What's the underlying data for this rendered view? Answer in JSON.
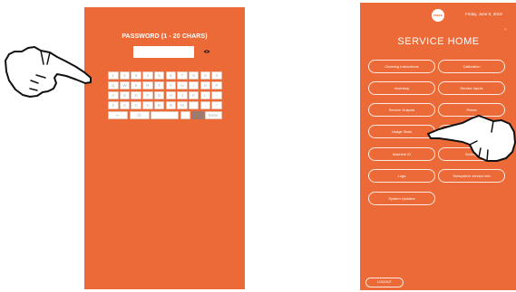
{
  "left_screen": {
    "title": "PASSWORD (1 - 20 CHARS)",
    "password_value": "",
    "eye_icon": "eye-icon",
    "keyboard_rows": [
      [
        "1",
        "2",
        "3",
        "4",
        "5",
        "6",
        "7",
        "8",
        "9",
        "0"
      ],
      [
        "Q",
        "W",
        "E",
        "R",
        "T",
        "Y",
        "U",
        "I",
        "O",
        "P"
      ],
      [
        "A",
        "S",
        "D",
        "F",
        "G",
        "H",
        "J",
        "K",
        "L",
        "-"
      ],
      [
        "Z",
        "X",
        "C",
        "V",
        "B",
        "N",
        "M",
        ".",
        ",",
        "/"
      ]
    ],
    "bottom_row": {
      "backspace_label": "⇐",
      "at_label": "@",
      "space_label": "",
      "period_label": ".",
      "shift_label": "",
      "enter_label": "Enter"
    }
  },
  "right_screen": {
    "logo_text": "FRESH BLENDS",
    "date": "Friday, June 8, 2018",
    "tiny_mark": "(((",
    "title": "SERVICE HOME",
    "buttons_left": [
      "Cleaning Instructions",
      "Inventory",
      "Service Outputs",
      "Usage Stats",
      "Machine ID",
      "Logs",
      "System Updates"
    ],
    "buttons_right": [
      "Calibration",
      "Service Inputs",
      "Prices",
      "",
      "Settings",
      "Subsystem version info"
    ],
    "logout_label": "LOGOUT"
  },
  "colors": {
    "panel": "#ec6a37",
    "key_text": "#b0b0b0",
    "key_dark": "#9c7a6e"
  }
}
